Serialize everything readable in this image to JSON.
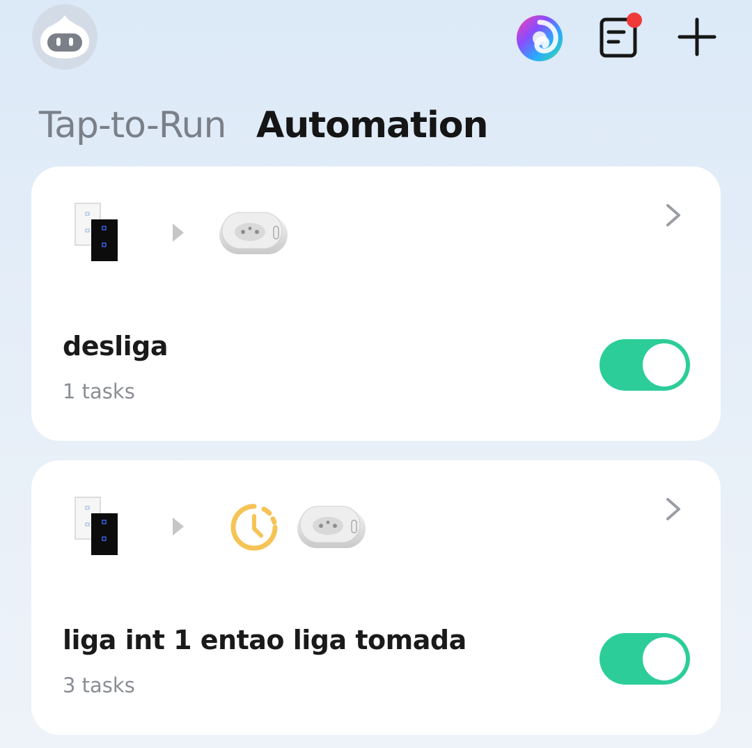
{
  "header": {
    "avatar_icon": "robot-avatar-icon",
    "ai_icon": "ai-assistant-swirl-icon",
    "log_icon": "log-document-icon",
    "add_icon": "plus-icon",
    "notification_dot_color": "#f03a3a"
  },
  "tabs": [
    {
      "label": "Tap-to-Run",
      "active": false
    },
    {
      "label": "Automation",
      "active": true
    }
  ],
  "automations": [
    {
      "title": "desliga",
      "subtitle": "1 tasks",
      "enabled": true,
      "condition_icons": [
        "wall-switch-icon"
      ],
      "action_icons": [
        "smart-plug-icon"
      ]
    },
    {
      "title": "liga int 1 entao liga tomada",
      "subtitle": "3 tasks",
      "enabled": true,
      "condition_icons": [
        "wall-switch-icon"
      ],
      "action_icons": [
        "delay-timer-icon",
        "smart-plug-icon"
      ]
    }
  ],
  "colors": {
    "toggle_on": "#2ccd98",
    "timer": "#f6c356",
    "active_tab": "#151515",
    "inactive_tab": "#7a8089"
  }
}
